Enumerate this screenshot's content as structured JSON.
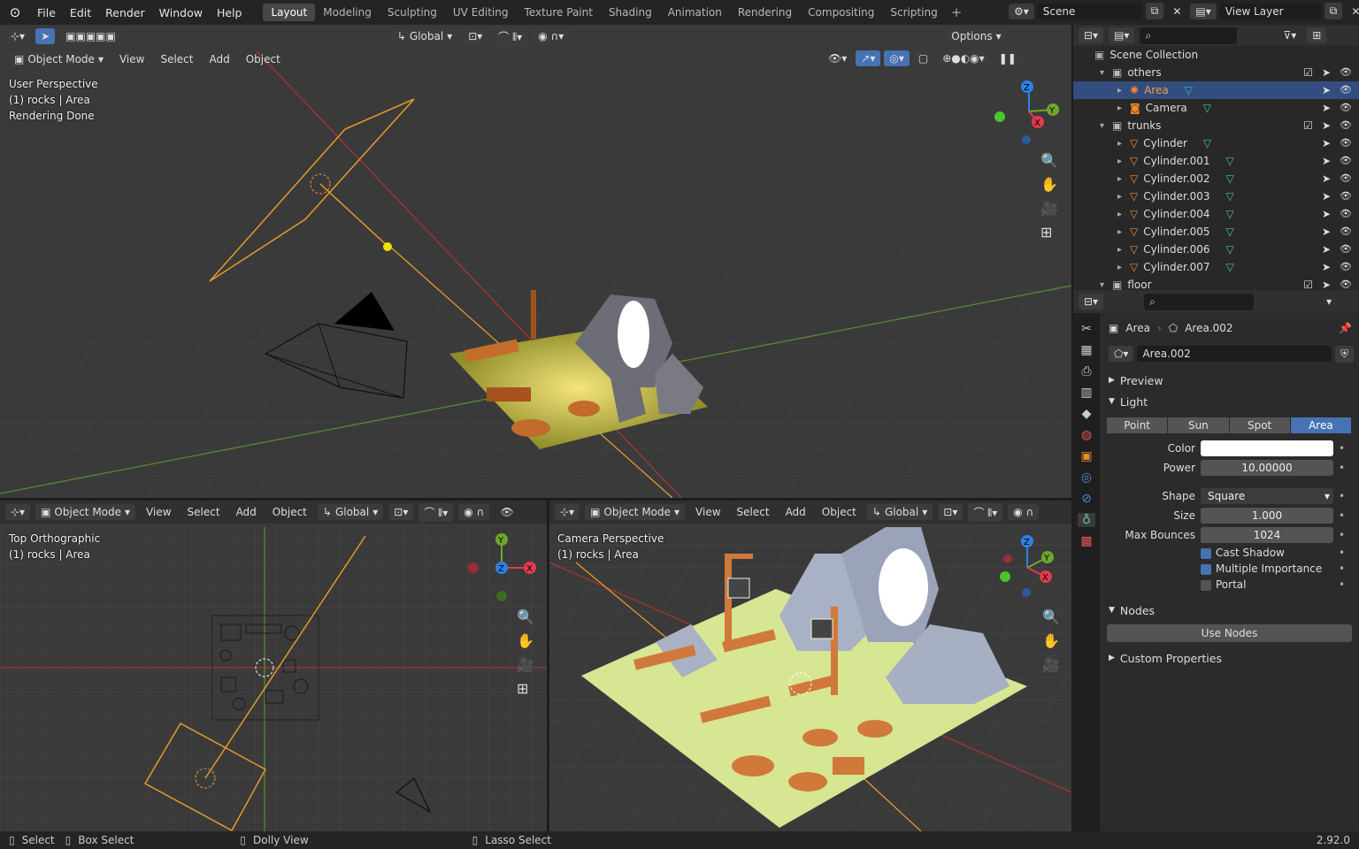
{
  "menu": [
    "File",
    "Edit",
    "Render",
    "Window",
    "Help"
  ],
  "workspaces": [
    "Layout",
    "Modeling",
    "Sculpting",
    "UV Editing",
    "Texture Paint",
    "Shading",
    "Animation",
    "Rendering",
    "Compositing",
    "Scripting"
  ],
  "scene": "Scene",
  "view_layer": "View Layer",
  "vp_top": {
    "mode": "Object Mode",
    "menus": [
      "View",
      "Select",
      "Add",
      "Object"
    ],
    "transform": "Global",
    "options": "Options",
    "overlay": [
      "User Perspective",
      "(1) rocks | Area",
      "Rendering Done"
    ]
  },
  "vp_bl": {
    "mode": "Object Mode",
    "menus": [
      "View",
      "Select",
      "Add",
      "Object"
    ],
    "transform": "Global",
    "overlay": [
      "Top Orthographic",
      "(1) rocks | Area"
    ]
  },
  "vp_br": {
    "mode": "Object Mode",
    "menus": [
      "View",
      "Select",
      "Add",
      "Object"
    ],
    "transform": "Global",
    "overlay": [
      "Camera Perspective",
      "(1) rocks | Area"
    ]
  },
  "gizmo": {
    "x": "X",
    "y": "Y",
    "z": "Z"
  },
  "outliner": {
    "root": "Scene Collection",
    "rows": [
      {
        "name": "others",
        "indent": 1,
        "type": "collection"
      },
      {
        "name": "Area",
        "indent": 2,
        "type": "light",
        "sel": true
      },
      {
        "name": "Camera",
        "indent": 2,
        "type": "camera"
      },
      {
        "name": "trunks",
        "indent": 1,
        "type": "collection"
      },
      {
        "name": "Cylinder",
        "indent": 2,
        "type": "mesh"
      },
      {
        "name": "Cylinder.001",
        "indent": 2,
        "type": "mesh"
      },
      {
        "name": "Cylinder.002",
        "indent": 2,
        "type": "mesh"
      },
      {
        "name": "Cylinder.003",
        "indent": 2,
        "type": "mesh"
      },
      {
        "name": "Cylinder.004",
        "indent": 2,
        "type": "mesh"
      },
      {
        "name": "Cylinder.005",
        "indent": 2,
        "type": "mesh"
      },
      {
        "name": "Cylinder.006",
        "indent": 2,
        "type": "mesh"
      },
      {
        "name": "Cylinder.007",
        "indent": 2,
        "type": "mesh"
      },
      {
        "name": "floor",
        "indent": 1,
        "type": "collection"
      }
    ]
  },
  "props": {
    "object": "Area",
    "data": "Area.002",
    "datablock": "Area.002",
    "sections": {
      "preview": "Preview",
      "light": "Light",
      "nodes": "Nodes",
      "custom": "Custom Properties"
    },
    "light_types": [
      "Point",
      "Sun",
      "Spot",
      "Area"
    ],
    "active_type": "Area",
    "color_label": "Color",
    "color": "#ffffff",
    "power_label": "Power",
    "power": "10.00000",
    "shape_label": "Shape",
    "shape": "Square",
    "size_label": "Size",
    "size": "1.000",
    "bounces_label": "Max Bounces",
    "bounces": "1024",
    "cast_shadow": "Cast Shadow",
    "multiple_importance": "Multiple Importance",
    "portal": "Portal",
    "use_nodes": "Use Nodes"
  },
  "status": {
    "select": "Select",
    "box_select": "Box Select",
    "dolly": "Dolly View",
    "lasso": "Lasso Select",
    "version": "2.92.0"
  }
}
